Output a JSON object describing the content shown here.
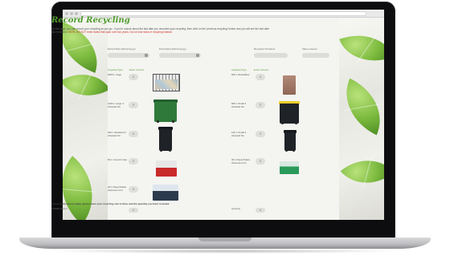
{
  "page": {
    "title": "Record Recycling",
    "intro_main": "On this page you can record your recycling as you go - if you're unsure about the last date you recorded your recycling, then click on the 'previous recycling' button and you will see the last date you recorded.",
    "intro_warning": "NOTE: DO NOT enter dates that span over two years. Do not lose track of recycling instead."
  },
  "filters": {
    "period_start_label": "Period Start (dd/mm/yyyy)",
    "period_end_label": "Period End (dd/mm/yyyy)",
    "recycler_label": "Recycled Via Name",
    "reseller_label": "Value entered"
  },
  "columns": {
    "left_type": "Capacity/Type",
    "left_amount": "Enter Amount",
    "right_type": "Capacity/Type",
    "right_amount": "Enter Amount"
  },
  "left_items": [
    {
      "label": "3000 L Cage",
      "value": "0"
    },
    {
      "label": "1100 L Large 4 wheeled bin",
      "value": "0"
    },
    {
      "label": "240 L Standard 2 wheeled bin",
      "value": "0"
    },
    {
      "label": "60 L Council crate",
      "value": "0"
    },
    {
      "label": "40 L Paper/Glass classroom bin",
      "value": "0"
    }
  ],
  "right_items": [
    {
      "label": "660 L Recitables",
      "value": "0"
    },
    {
      "label": "660 L Small 4 wheeled bin",
      "value": "0"
    },
    {
      "label": "120 L Small 2 wheeled bin",
      "value": "0"
    },
    {
      "label": "30 L Paper/Glass classroom bin",
      "value": "0"
    }
  ],
  "bottom": {
    "note": "If none of the above apply, please enter your recycling size in litres and the quantity you have recycled.",
    "other_label": "OTHER (litres)",
    "other_value": "0",
    "quantity_label": "Quantity",
    "quantity_value": "0"
  },
  "colors": {
    "accent_green": "#4e9b2b",
    "warning_red": "#d2332b",
    "bin_green": "#2f7a3a",
    "bin_black": "#1f2226",
    "bin_red": "#c92a2a",
    "bin_yellow_lid": "#f2d02a",
    "crate_green": "#2a9a5a"
  }
}
